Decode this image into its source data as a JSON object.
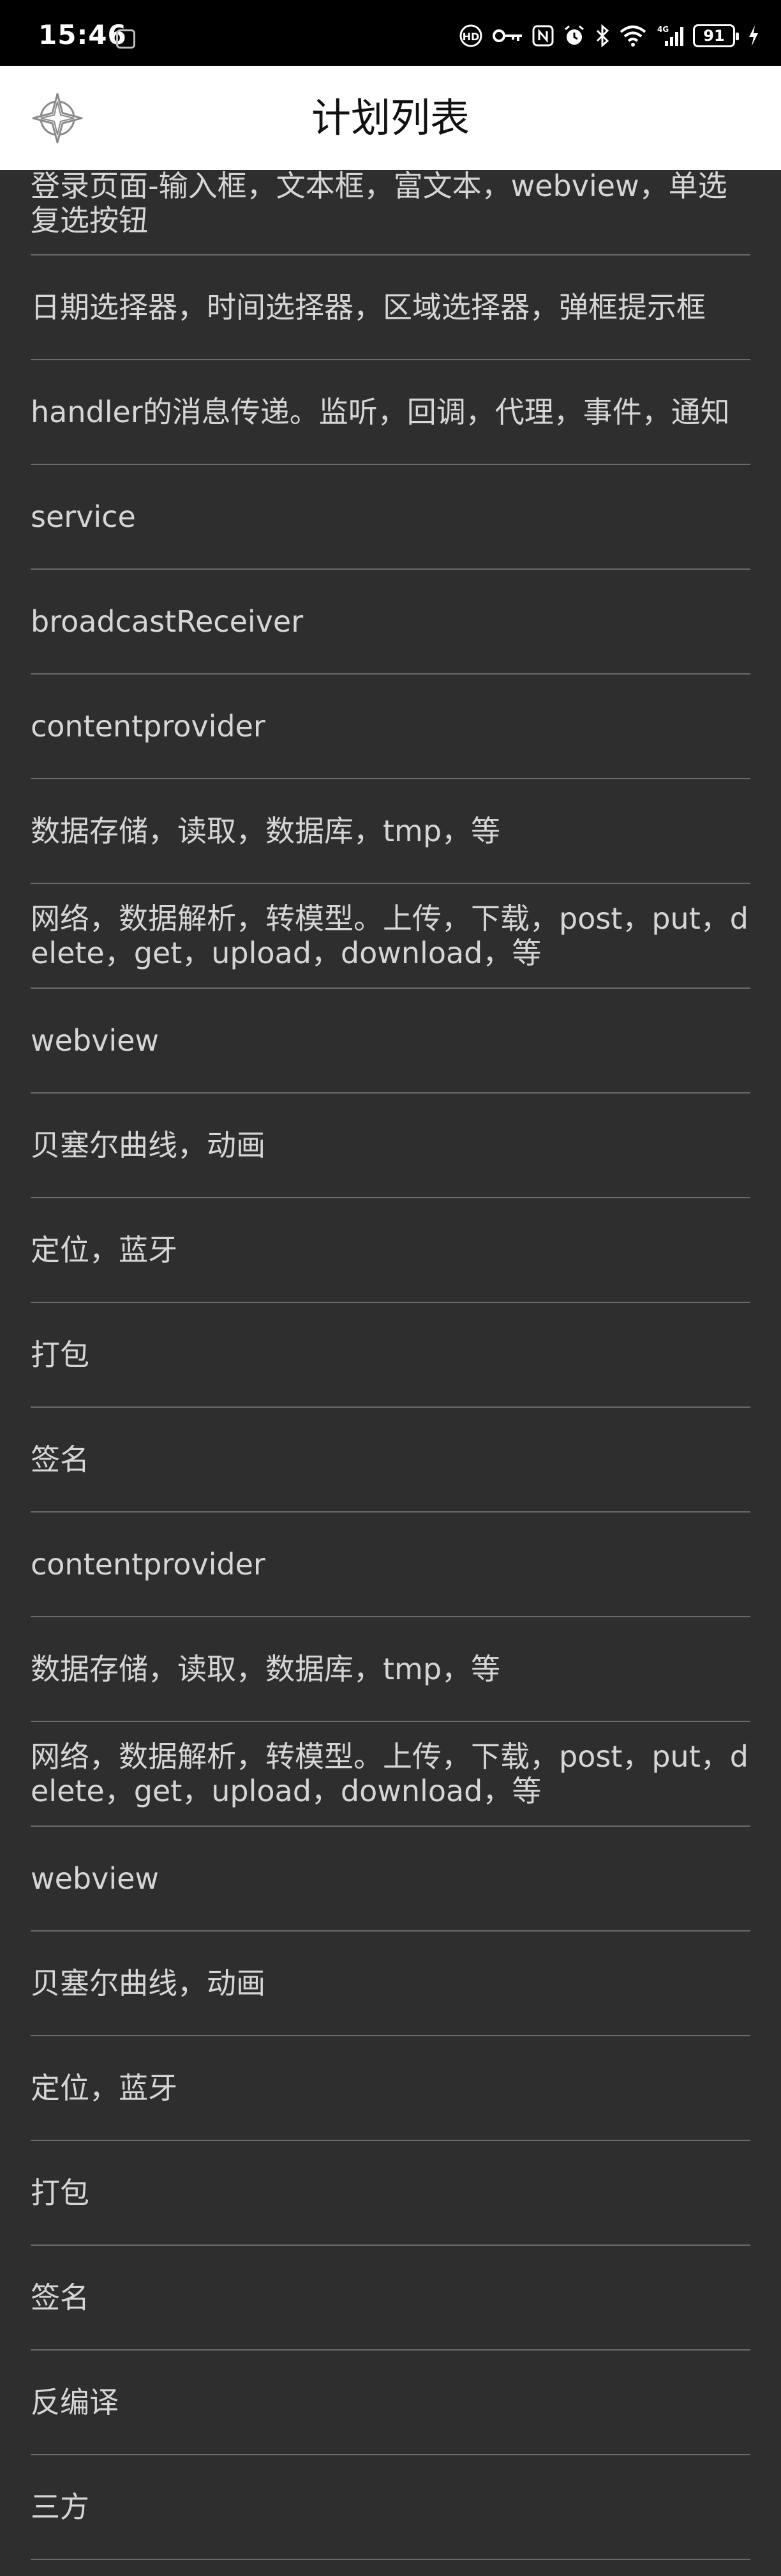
{
  "status_bar": {
    "time": "15:46",
    "network": "4G",
    "battery": "91"
  },
  "app_bar": {
    "title": "计划列表",
    "logo_icon": "compass-star-icon"
  },
  "plan_list": {
    "items": [
      "登录页面-输入框，文本框，富文本，webview，单选复选按钮",
      "日期选择器，时间选择器，区域选择器，弹框提示框",
      "handler的消息传递。监听，回调，代理，事件，通知",
      "service",
      "broadcastReceiver",
      "contentprovider",
      "数据存储，读取，数据库，tmp，等",
      "网络，数据解析，转模型。上传，下载，post，put，delete，get，upload，download，等",
      "webview",
      "贝塞尔曲线，动画",
      "定位，蓝牙",
      "打包",
      "签名",
      "contentprovider",
      "数据存储，读取，数据库，tmp，等",
      "网络，数据解析，转模型。上传，下载，post，put，delete，get，upload，download，等",
      "webview",
      "贝塞尔曲线，动画",
      "定位，蓝牙",
      "打包",
      "签名",
      "反编译",
      "三方"
    ]
  }
}
